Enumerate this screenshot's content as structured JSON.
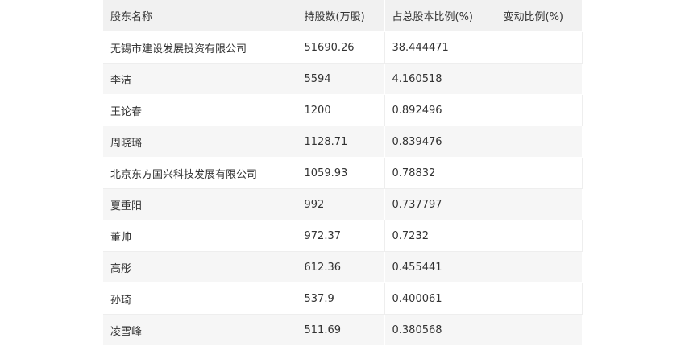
{
  "table": {
    "headers": [
      "股东名称",
      "持股数(万股)",
      "占总股本比例(%)",
      "变动比例(%)"
    ],
    "rows": [
      [
        "无锡市建设发展投资有限公司",
        "51690.26",
        "38.444471",
        ""
      ],
      [
        "李洁",
        "5594",
        "4.160518",
        ""
      ],
      [
        "王论春",
        "1200",
        "0.892496",
        ""
      ],
      [
        "周晓璐",
        "1128.71",
        "0.839476",
        ""
      ],
      [
        "北京东方国兴科技发展有限公司",
        "1059.93",
        "0.78832",
        ""
      ],
      [
        "夏重阳",
        "992",
        "0.737797",
        ""
      ],
      [
        "董帅",
        "972.37",
        "0.7232",
        ""
      ],
      [
        "高彤",
        "612.36",
        "0.455441",
        ""
      ],
      [
        "孙琦",
        "537.9",
        "0.400061",
        ""
      ],
      [
        "凌雪峰",
        "511.69",
        "0.380568",
        ""
      ]
    ]
  }
}
